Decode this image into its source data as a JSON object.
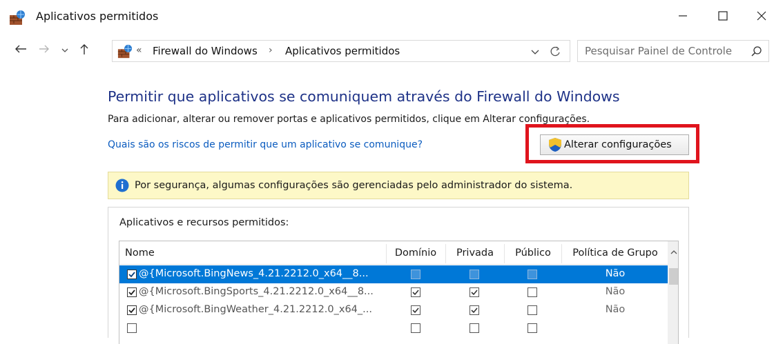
{
  "window": {
    "title": "Aplicativos permitidos"
  },
  "nav": {
    "breadcrumb_chevron": "«",
    "breadcrumb": [
      "Firewall do Windows",
      "Aplicativos permitidos"
    ],
    "breadcrumb_sep": "›",
    "search_placeholder": "Pesquisar Painel de Controle"
  },
  "main": {
    "heading": "Permitir que aplicativos se comuniquem através do Firewall do Windows",
    "description": "Para adicionar, alterar ou remover portas e aplicativos permitidos, clique em Alterar configurações.",
    "risk_link": "Quais são os riscos de permitir que um aplicativo se comunique?",
    "change_settings_label": "Alterar configurações",
    "info_message": "Por segurança, algumas configurações são gerenciadas pelo administrador do sistema."
  },
  "allowed_apps": {
    "group_label": "Aplicativos e recursos permitidos:",
    "columns": [
      "Nome",
      "Domínio",
      "Privada",
      "Público",
      "Política de Grupo"
    ],
    "rows": [
      {
        "name": "@{Microsoft.BingNews_4.21.2212.0_x64__8...",
        "enabled": true,
        "domain": false,
        "private": false,
        "public": false,
        "group_policy": "Não",
        "selected": true
      },
      {
        "name": "@{Microsoft.BingSports_4.21.2212.0_x64__8...",
        "enabled": true,
        "domain": true,
        "private": true,
        "public": false,
        "group_policy": "Não",
        "selected": false
      },
      {
        "name": "@{Microsoft.BingWeather_4.21.2212.0_x64_...",
        "enabled": true,
        "domain": true,
        "private": true,
        "public": false,
        "group_policy": "Não",
        "selected": false
      },
      {
        "name": "",
        "enabled": false,
        "domain": false,
        "private": false,
        "public": false,
        "group_policy": "",
        "selected": false
      }
    ]
  },
  "colors": {
    "heading": "#1e3287",
    "link": "#0a5bbf",
    "selection": "#0078d7",
    "highlight_border": "#e0141d",
    "info_bg": "#fdf8c7"
  }
}
